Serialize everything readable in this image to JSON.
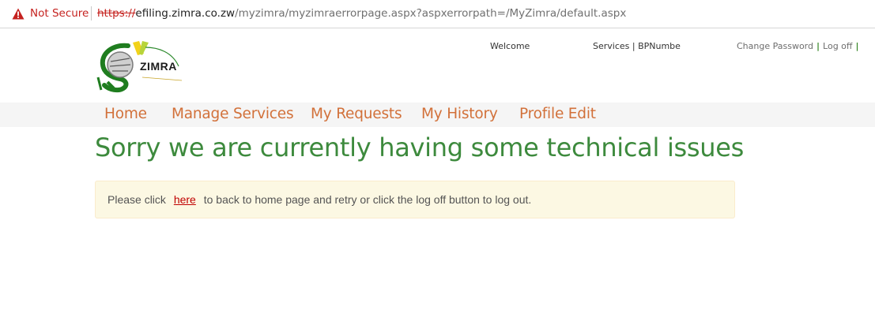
{
  "browser": {
    "security_label": "Not Secure",
    "url_scheme": "https://",
    "url_host": "efiling.zimra.co.zw",
    "url_path": "/myzimra/myzimraerrorpage.aspx?aspxerrorpath=/MyZimra/default.aspx",
    "icons": {
      "security": "warning-triangle-icon"
    }
  },
  "header": {
    "logo_text": "ZIMRA",
    "welcome_label": "Welcome",
    "services_label": "Services | BPNumbe",
    "change_password": "Change Password",
    "log_off": "Log off",
    "link_separator": "|"
  },
  "nav": {
    "items": [
      {
        "label": "Home"
      },
      {
        "label": "Manage Services"
      },
      {
        "label": "My Requests"
      },
      {
        "label": "My History"
      },
      {
        "label": "Profile Edit"
      }
    ]
  },
  "main": {
    "heading": "Sorry we are currently having some technical issues",
    "alert": {
      "prefix": "Please click",
      "link_text": "here",
      "suffix": "to back to home page and retry or click the log off button to log out."
    }
  },
  "colors": {
    "nav_link": "#d2713a",
    "heading": "#3d8a3d",
    "alert_bg": "#fcf8e3",
    "alert_link": "#c00000",
    "not_secure": "#c5221f"
  }
}
